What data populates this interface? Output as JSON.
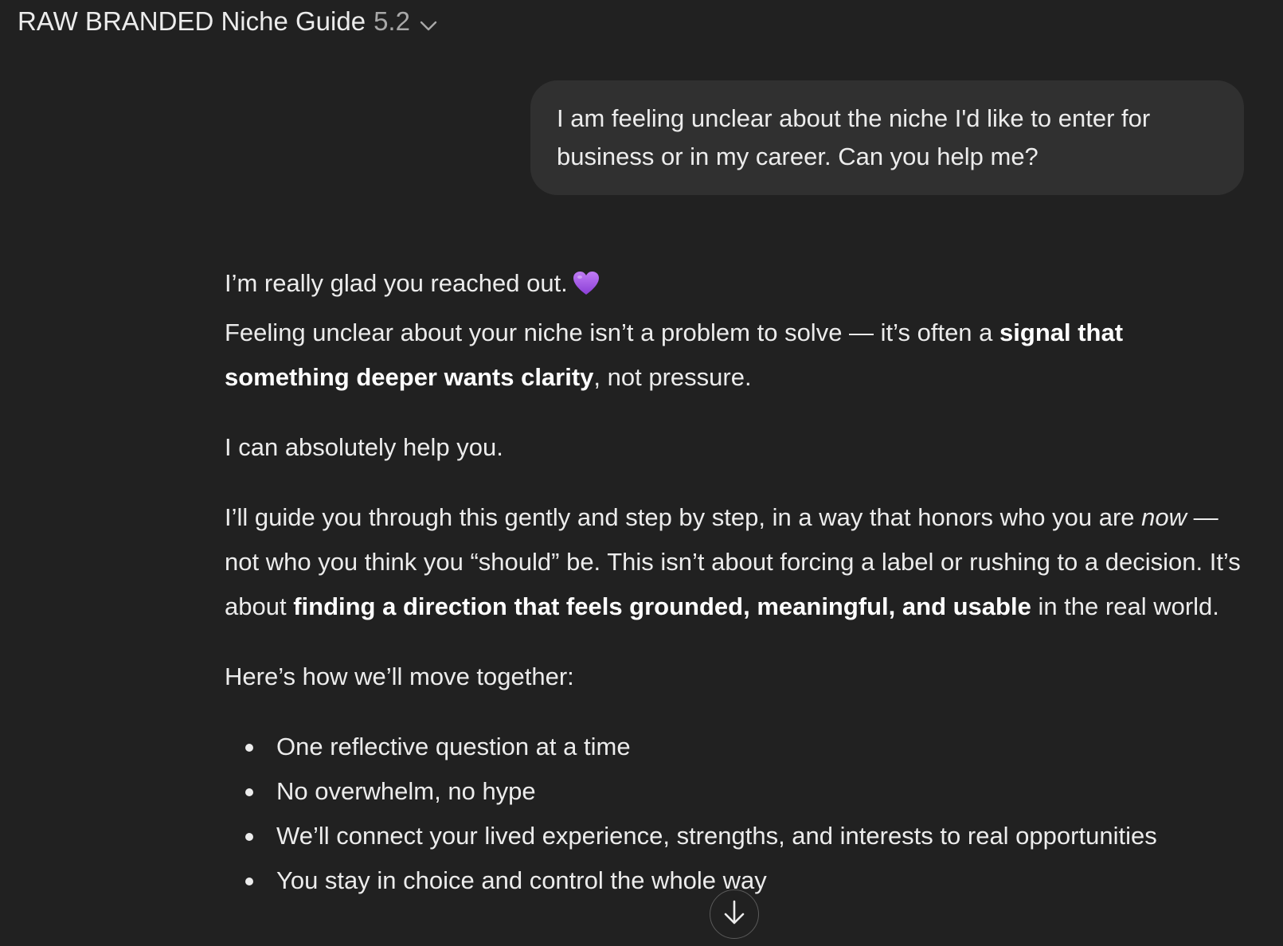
{
  "header": {
    "title": "RAW BRANDED Niche Guide",
    "version": "5.2",
    "chevron_icon": "chevron-down-icon"
  },
  "user_message": {
    "text": "I am feeling unclear about the niche I'd like to enter for business or in my career. Can you help me?"
  },
  "assistant": {
    "line1": "I’m really glad you reached out.",
    "heart_icon": "purple-heart-icon",
    "p1_a": "Feeling unclear about your niche isn’t a problem to solve — it’s often a ",
    "p1_b": "signal that something deeper wants clarity",
    "p1_c": ", not pressure.",
    "p2": "I can absolutely help you.",
    "p3_a": "I’ll guide you through this gently and step by step, in a way that honors who you are ",
    "p3_b": "now",
    "p3_c": " — not who you think you “should” be. This isn’t about forcing a label or rushing to a decision. It’s about ",
    "p3_d": "finding a direction that feels grounded, meaningful, and usable",
    "p3_e": " in the real world.",
    "p4": "Here’s how we’ll move together:",
    "bullets": [
      "One reflective question at a time",
      "No overwhelm, no hype",
      "We’ll connect your lived experience, strengths, and interests to real opportunities",
      "You stay in choice and control the whole way"
    ]
  },
  "scroll_button": {
    "icon": "arrow-down-icon"
  },
  "colors": {
    "background": "#212121",
    "user_bubble": "#303030",
    "text": "#ececec",
    "heart": "#a259e6"
  }
}
